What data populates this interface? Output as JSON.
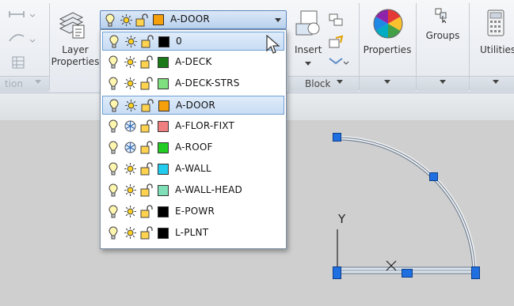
{
  "ribbon": {
    "layer_properties_label_1": "Layer",
    "layer_properties_label_2": "Properties",
    "insert_label": "Insert",
    "properties_label": "Properties",
    "groups_label": "Groups",
    "utilities_label": "Utilities",
    "block_footer_label": "Block",
    "left_footer_label": "tion"
  },
  "layer_combo": {
    "current_layer": "A-DOOR",
    "current_color": "#f5a00a"
  },
  "layers": [
    {
      "name": "0",
      "color": "#000000",
      "frozen": false,
      "highlight": "selected"
    },
    {
      "name": "A-DECK",
      "color": "#1a7a1a",
      "frozen": false
    },
    {
      "name": "A-DECK-STRS",
      "color": "#7fe07f",
      "frozen": false
    },
    {
      "name": "A-DOOR",
      "color": "#f5a00a",
      "frozen": false,
      "highlight": "current"
    },
    {
      "name": "A-FLOR-FIXT",
      "color": "#f08080",
      "frozen": true
    },
    {
      "name": "A-ROOF",
      "color": "#22cc22",
      "frozen": true
    },
    {
      "name": "A-WALL",
      "color": "#22ccee",
      "frozen": false
    },
    {
      "name": "A-WALL-HEAD",
      "color": "#7fe0b8",
      "frozen": false
    },
    {
      "name": "E-POWR",
      "color": "#000000",
      "frozen": false
    },
    {
      "name": "L-PLNT",
      "color": "#000000",
      "frozen": false
    }
  ],
  "drawing": {
    "ucs_y_label": "Y",
    "ucs_x_label": "X",
    "grip_color": "#1f6fe0"
  }
}
